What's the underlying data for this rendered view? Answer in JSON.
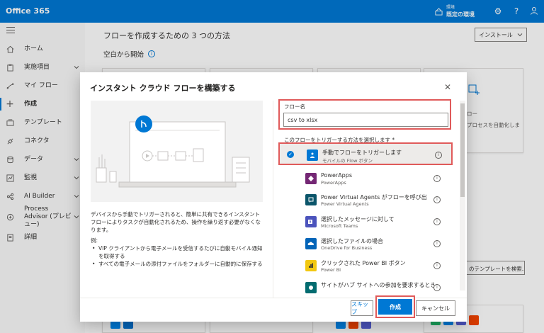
{
  "app": {
    "title": "Office 365"
  },
  "topbar": {
    "env_label": "環境",
    "env_name": "既定の環境",
    "icons": [
      "environment-icon",
      "gear-icon",
      "help-icon",
      "user-icon"
    ]
  },
  "nav": {
    "items": [
      {
        "label": "ホーム",
        "icon": "home-icon",
        "chevron": false,
        "active": false
      },
      {
        "label": "実施項目",
        "icon": "clipboard-icon",
        "chevron": true,
        "active": false
      },
      {
        "label": "マイ フロー",
        "icon": "flow-icon",
        "chevron": false,
        "active": false
      },
      {
        "label": "作成",
        "icon": "plus-icon",
        "chevron": false,
        "active": true
      },
      {
        "label": "テンプレート",
        "icon": "template-icon",
        "chevron": false,
        "active": false
      },
      {
        "label": "コネクタ",
        "icon": "connector-icon",
        "chevron": false,
        "active": false
      },
      {
        "label": "データ",
        "icon": "database-icon",
        "chevron": true,
        "active": false
      },
      {
        "label": "監視",
        "icon": "monitor-icon",
        "chevron": true,
        "active": false
      },
      {
        "label": "AI Builder",
        "icon": "ai-icon",
        "chevron": true,
        "active": false
      },
      {
        "label": "Process Advisor (プレビュー)",
        "icon": "process-icon",
        "chevron": true,
        "active": false
      },
      {
        "label": "詳細",
        "icon": "book-icon",
        "chevron": false,
        "active": false
      }
    ]
  },
  "main": {
    "title": "フローを作成するための 3 つの方法",
    "install_label": "インストール",
    "sub_heading": "空白から開始",
    "bg_card_text_1": "ロー",
    "bg_card_text_2": "プロセスを自動化しま",
    "template_search": "のテンプレートを検索..."
  },
  "dialog": {
    "title": "インスタント クラウド フローを構築する",
    "description": "デバイスから手動でトリガーされると、簡単に共有できるインスタント フローによりタスクが自動化されるため、操作を繰り返す必要がなくなります。",
    "example_label": "例:",
    "examples": [
      "VIP クライアントから電子メールを受信するたびに自動モバイル通知を取得する",
      "すべての電子メールの添付ファイルをフォルダーに自動的に保存する"
    ],
    "flow_name_label": "フロー名",
    "flow_name_value": "csv to xlsx",
    "trigger_label": "このフローをトリガーする方法を選択します *",
    "triggers": [
      {
        "title": "手動でフローをトリガーします",
        "subtitle": "モバイルの Flow ボタン",
        "icon": "touch-icon",
        "color": "#0078d4",
        "selected": true
      },
      {
        "title": "PowerApps",
        "subtitle": "PowerApps",
        "icon": "powerapps-icon",
        "color": "#742774",
        "selected": false
      },
      {
        "title": "Power Virtual Agents がフローを呼び出...",
        "subtitle": "Power Virtual Agents",
        "icon": "pva-icon",
        "color": "#0b556a",
        "selected": false
      },
      {
        "title": "選択したメッセージに対して",
        "subtitle": "Microsoft Teams",
        "icon": "teams-icon",
        "color": "#4b53bc",
        "selected": false
      },
      {
        "title": "選択したファイルの場合",
        "subtitle": "OneDrive for Business",
        "icon": "onedrive-icon",
        "color": "#0364b8",
        "selected": false
      },
      {
        "title": "クリックされた Power BI ボタン",
        "subtitle": "Power BI",
        "icon": "powerbi-icon",
        "color": "#f2c811",
        "selected": false
      },
      {
        "title": "サイトがハブ サイトへの参加を要求するとき",
        "subtitle": "",
        "icon": "sharepoint-icon",
        "color": "#036c70",
        "selected": false
      }
    ],
    "buttons": {
      "skip": "スキップ",
      "create": "作成",
      "cancel": "キャンセル"
    }
  },
  "colors": {
    "accent": "#0078d4",
    "highlight": "#e05a5a"
  }
}
